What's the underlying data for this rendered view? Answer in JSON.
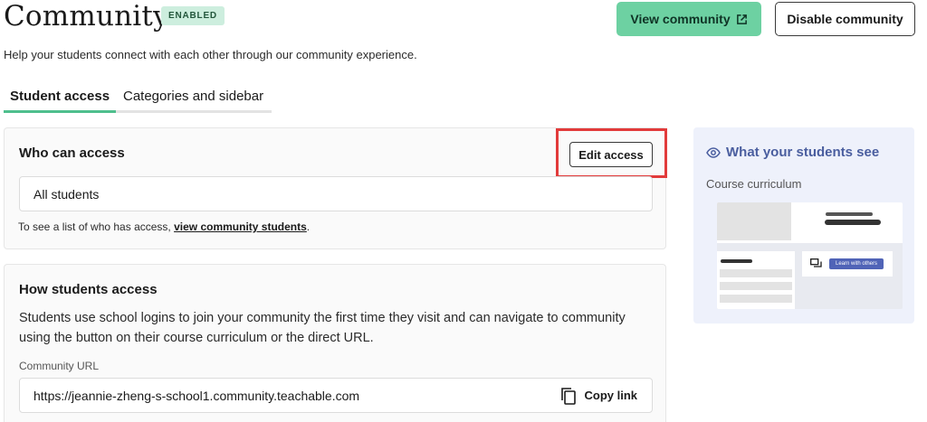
{
  "header": {
    "title": "Community",
    "status_badge": "ENABLED",
    "view_button": "View community",
    "disable_button": "Disable community",
    "subtitle": "Help your students connect with each other through our community experience."
  },
  "tabs": [
    {
      "label": "Student access",
      "active": true
    },
    {
      "label": "Categories and sidebar",
      "active": false
    }
  ],
  "who_can_access": {
    "heading": "Who can access",
    "edit_button": "Edit access",
    "value": "All students",
    "help_prefix": "To see a list of who has access, ",
    "help_link": "view community students",
    "help_suffix": "."
  },
  "how_students_access": {
    "heading": "How students access",
    "description": "Students use school logins to join your community the first time they visit and can navigate to community using the button on their course curriculum or the direct URL.",
    "url_label": "Community URL",
    "url_value": "https://jeannie-zheng-s-school1.community.teachable.com",
    "copy_button": "Copy link"
  },
  "preview": {
    "heading": "What your students see",
    "subheading": "Course curriculum",
    "mock_button": "Learn with others"
  },
  "icons": {
    "external": "external-link-icon",
    "copy": "copy-icon",
    "eye": "eye-icon",
    "chat": "chat-icon"
  },
  "colors": {
    "accent_green": "#6dd1a2",
    "badge_bg": "#cdeede",
    "highlight_red": "#e23b3b",
    "preview_bg": "#eef1fb",
    "preview_accent": "#4a5e9f",
    "mock_button": "#5064b7"
  }
}
